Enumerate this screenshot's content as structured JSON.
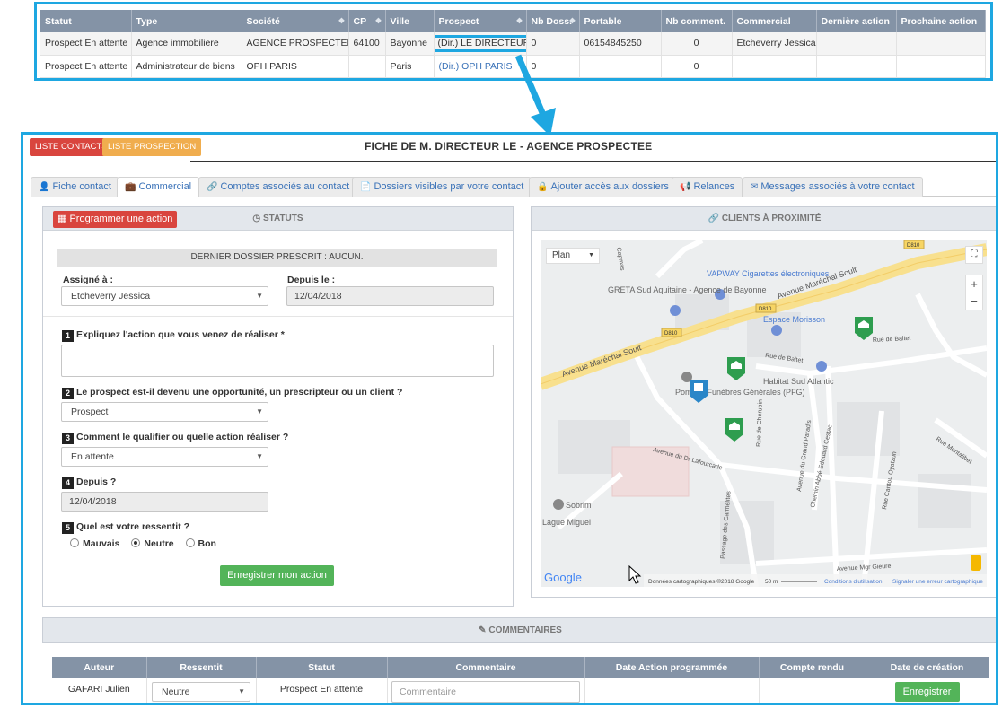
{
  "top_table": {
    "headers": [
      "Statut",
      "Type",
      "Société",
      "CP",
      "Ville",
      "Prospect",
      "Nb Doss.",
      "Portable",
      "Nb comment.",
      "Commercial",
      "Dernière action",
      "Prochaine action"
    ],
    "rows": [
      [
        "Prospect En attente",
        "Agence immobiliere",
        "AGENCE PROSPECTEE",
        "64100",
        "Bayonne",
        "(Dir.) LE DIRECTEUR",
        "0",
        "06154845250",
        "0",
        "Etcheverry Jessica",
        "",
        ""
      ],
      [
        "Prospect En attente",
        "Administrateur de biens",
        "OPH PARIS",
        "",
        "Paris",
        "(Dir.) OPH PARIS",
        "0",
        "",
        "0",
        "",
        "",
        ""
      ]
    ]
  },
  "header": {
    "btn_liste_contacts": "LISTE CONTACTS",
    "btn_liste_prospection": "LISTE PROSPECTION",
    "title": "FICHE DE M. DIRECTEUR LE - AGENCE PROSPECTEE"
  },
  "tabs": [
    {
      "label": "Fiche contact",
      "icon": "user-icon"
    },
    {
      "label": "Commercial",
      "icon": "briefcase-icon"
    },
    {
      "label": "Comptes associés au contact",
      "icon": "link-icon"
    },
    {
      "label": "Dossiers visibles par votre contact",
      "icon": "file-icon"
    },
    {
      "label": "Ajouter accès aux dossiers",
      "icon": "lock-icon"
    },
    {
      "label": "Relances",
      "icon": "bullhorn-icon"
    },
    {
      "label": "Messages associés à votre contact",
      "icon": "envelope-icon"
    }
  ],
  "statuts": {
    "program_button": "Programmer une action",
    "title": "STATUTS",
    "dernier_dossier": "DERNIER DOSSIER PRESCRIT : AUCUN.",
    "assigne_label": "Assigné à :",
    "assigne_value": "Etcheverry Jessica",
    "depuis_label": "Depuis le :",
    "depuis_value": "12/04/2018",
    "q1_num": "1",
    "q1": "Expliquez l'action que vous venez de réaliser *",
    "q2_num": "2",
    "q2": "Le prospect est-il devenu une opportunité, un prescripteur ou un client ?",
    "q2_value": "Prospect",
    "q3_num": "3",
    "q3": "Comment le qualifier ou quelle action réaliser ?",
    "q3_value": "En attente",
    "q4_num": "4",
    "q4": "Depuis ?",
    "q4_value": "12/04/2018",
    "q5_num": "5",
    "q5": "Quel est votre ressentit ?",
    "radio_options": [
      "Mauvais",
      "Neutre",
      "Bon"
    ],
    "radio_selected": "Neutre",
    "submit": "Enregistrer mon action"
  },
  "clients": {
    "title": "CLIENTS À PROXIMITÉ",
    "map": {
      "type_select": "Plan",
      "streets": [
        "Avenue Maréchal Soult",
        "Avenue Maréchal Soult",
        "Rue de Baltet",
        "Rue de Baltet",
        "Rue de Cherubin",
        "Avenue du Grand Paradis",
        "Chemin Abbé Edouard Cestac",
        "Avenue du Dr Lafourcade",
        "Passage des Carmélites",
        "Avenue Mgr Gieure",
        "Rue Montalibet",
        "Rue Cantou Oyatzun",
        "Capmas"
      ],
      "road_labels": [
        "D810",
        "D810",
        "D810"
      ],
      "pois": [
        "VAPWAY Cigarettes électroniques",
        "GRETA Sud Aquitaine - Agence de Bayonne",
        "Espace Morisson",
        "Habitat Sud Atlantic",
        "Pompes Funèbres Générales (PFG)",
        "Sobrim",
        "Lague Miguel"
      ],
      "attribution": "Données cartographiques ©2018 Google",
      "scale": "50 m",
      "conditions": "Conditions d'utilisation",
      "report": "Signaler une erreur cartographique",
      "logo": "Google"
    }
  },
  "comments": {
    "title": "COMMENTAIRES",
    "headers": [
      "Auteur",
      "Ressentit",
      "Statut",
      "Commentaire",
      "Date Action programmée",
      "Compte rendu",
      "Date de création"
    ],
    "row": {
      "author": "GAFARI Julien",
      "ressentit": "Neutre",
      "statut": "Prospect En attente",
      "comment_placeholder": "Commentaire",
      "save": "Enregistrer"
    }
  },
  "colors": {
    "highlight": "#1ea7e1",
    "header_gray": "#8493a6",
    "red": "#d9453e",
    "orange": "#f0ad4e",
    "green": "#53b459",
    "link": "#3a72b8"
  }
}
